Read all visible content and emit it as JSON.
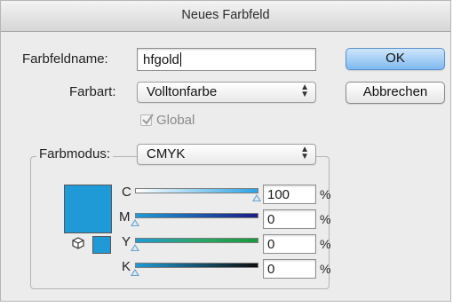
{
  "window": {
    "title": "Neues Farbfeld"
  },
  "form": {
    "name_label": "Farbfeldname:",
    "name_value": "hfgold",
    "type_label": "Farbart:",
    "type_value": "Volltonfarbe",
    "global_label": "Global",
    "global_checked": true,
    "mode_label": "Farbmodus:",
    "mode_value": "CMYK"
  },
  "buttons": {
    "ok": "OK",
    "cancel": "Abbrechen"
  },
  "swatch": {
    "color": "#1f9ad6"
  },
  "sliders": [
    {
      "label": "C",
      "value": "100",
      "unit": "%",
      "fraction": 1.0
    },
    {
      "label": "M",
      "value": "0",
      "unit": "%",
      "fraction": 0.0
    },
    {
      "label": "Y",
      "value": "0",
      "unit": "%",
      "fraction": 0.0
    },
    {
      "label": "K",
      "value": "0",
      "unit": "%",
      "fraction": 0.0
    }
  ],
  "icons": {
    "out_of_gamut": "cube-icon",
    "select_arrows": "up-down-arrows-icon"
  }
}
